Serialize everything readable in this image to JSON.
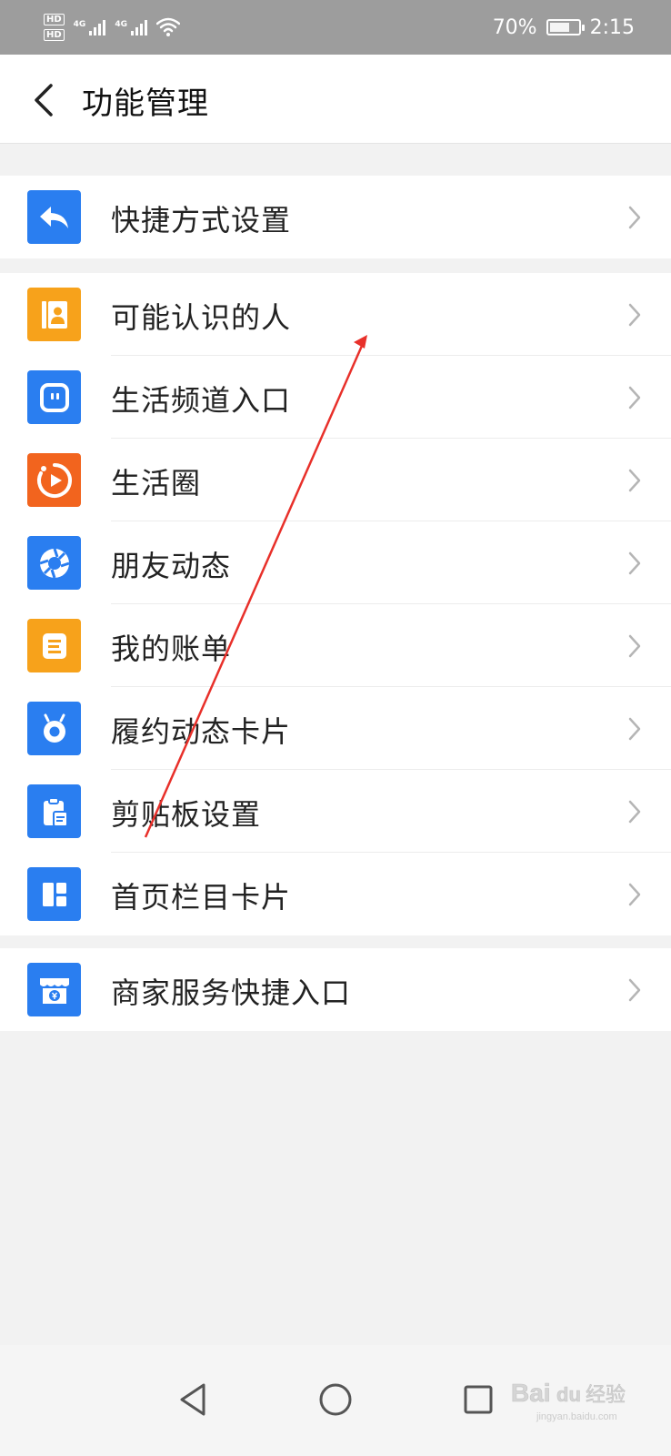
{
  "status_bar": {
    "hd1": "HD",
    "hd2": "HD",
    "net1": "4G",
    "net2": "4G",
    "battery": "70%",
    "battery_level": 0.7,
    "time": "2:15"
  },
  "header": {
    "title": "功能管理",
    "back_icon": "chevron-left-icon"
  },
  "groups": [
    {
      "items": [
        {
          "label": "快捷方式设置",
          "icon": "reply-arrow-icon",
          "color": "#2a7ef0"
        }
      ]
    },
    {
      "items": [
        {
          "label": "可能认识的人",
          "icon": "contact-card-icon",
          "color": "#f7a21b"
        },
        {
          "label": "生活频道入口",
          "icon": "tv-face-icon",
          "color": "#2a7ef0"
        },
        {
          "label": "生活圈",
          "icon": "play-circle-icon",
          "color": "#f2641e"
        },
        {
          "label": "朋友动态",
          "icon": "shutter-icon",
          "color": "#2a7ef0"
        },
        {
          "label": "我的账单",
          "icon": "bill-list-icon",
          "color": "#f7a21b"
        },
        {
          "label": "履约动态卡片",
          "icon": "fulfillment-ring-icon",
          "color": "#2a7ef0"
        },
        {
          "label": "剪贴板设置",
          "icon": "clipboard-icon",
          "color": "#2a7ef0"
        },
        {
          "label": "首页栏目卡片",
          "icon": "grid-layout-icon",
          "color": "#2a7ef0"
        }
      ]
    },
    {
      "items": [
        {
          "label": "商家服务快捷入口",
          "icon": "store-yuan-icon",
          "color": "#2a7ef0"
        }
      ]
    }
  ],
  "nav_bar": {
    "back": "triangle-back-icon",
    "home": "circle-home-icon",
    "recent": "square-recent-icon"
  },
  "watermark": {
    "text1": "Bai",
    "text2": "du",
    "text3": "经验",
    "sub": "jingyan.baidu.com"
  },
  "annotation": {
    "color": "#e8302a"
  }
}
